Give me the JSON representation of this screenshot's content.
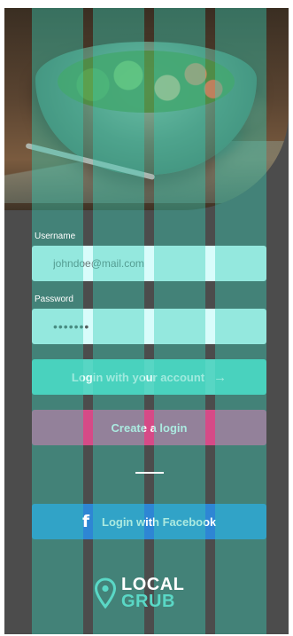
{
  "login_form": {
    "username_label": "Username",
    "username_value": "johndoe@mail.com",
    "password_label": "Password",
    "password_value": "•••••••"
  },
  "actions": {
    "login_label": "Login with your account",
    "login_arrow": "→",
    "create_label": "Create a login",
    "facebook_label": "Login with Facebook",
    "facebook_icon": "f"
  },
  "brand": {
    "line1": "LOCAL",
    "line2": "GRUB"
  },
  "colors": {
    "login_button": "#57d6c4",
    "create_button": "#d64a87",
    "facebook_button": "#2e86d4",
    "input_background": "#d8fcfb",
    "overlay_stripe": "#38cdb4"
  }
}
